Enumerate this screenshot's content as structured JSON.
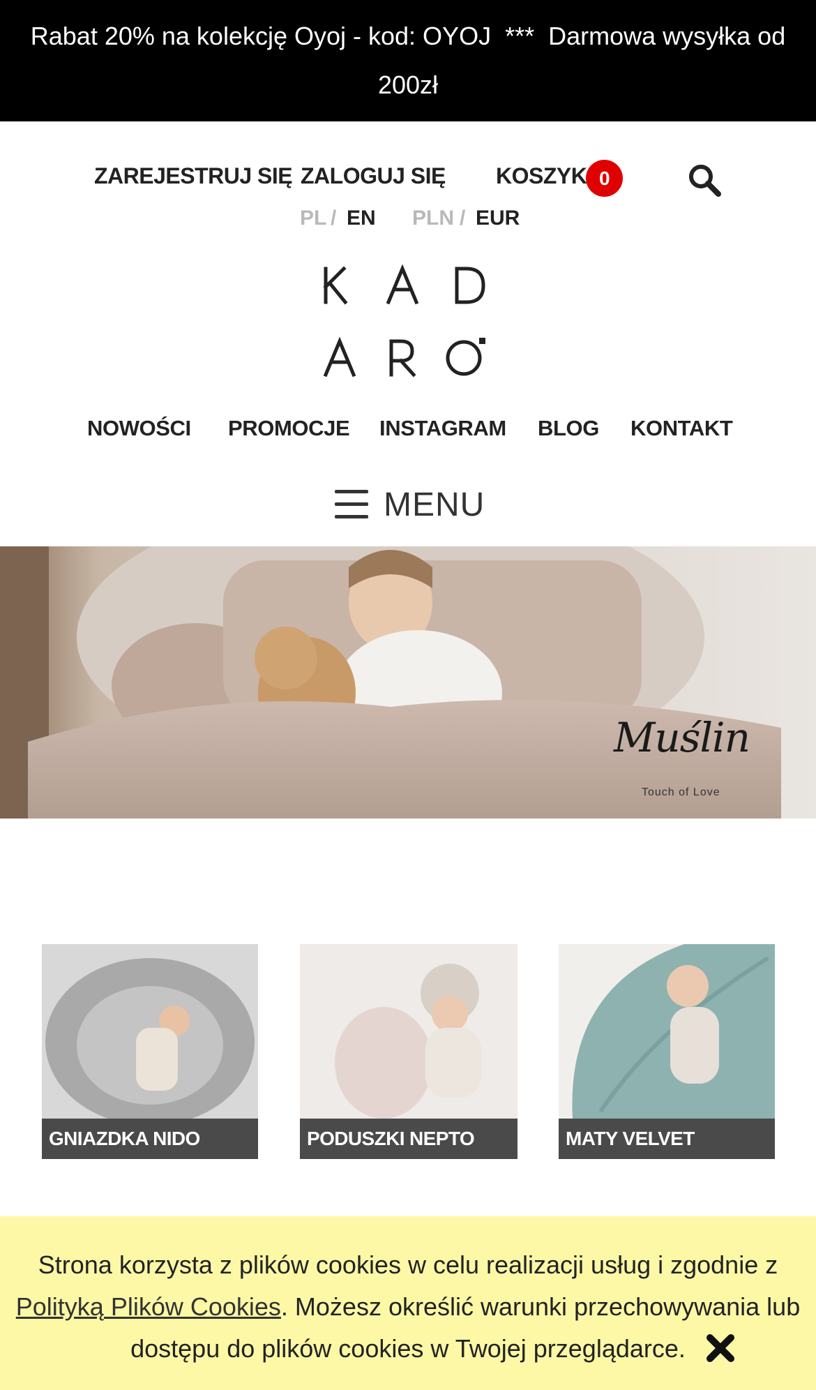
{
  "promo": {
    "line1": "Rabat 20% na kolekcję Oyoj - kod: OYOJ  ***  Darmowa wysyłka od",
    "line2": "200zł"
  },
  "user_nav": {
    "register": "ZAREJESTRUJ SIĘ",
    "login": "ZALOGUJ SIĘ",
    "cart": "KOSZYK",
    "cart_count": "0",
    "search_icon": "search-icon"
  },
  "languages": {
    "pl": "PL",
    "separator": "/",
    "en": "EN"
  },
  "currencies": {
    "pln": "PLN",
    "separator": "/",
    "eur": "EUR"
  },
  "logo": {
    "line1": "K A D",
    "line2": "A R O"
  },
  "main_nav": [
    "NOWOŚCI",
    "PROMOCJE",
    "INSTAGRAM",
    "BLOG",
    "KONTAKT"
  ],
  "menu": {
    "label": "MENU",
    "icon": "hamburger-icon"
  },
  "hero": {
    "script_title": "Muślin",
    "tagline": "Touch of Love"
  },
  "categories": [
    {
      "label": "GNIAZDKA NIDO"
    },
    {
      "label": "PODUSZKI NEPTO"
    },
    {
      "label": "MATY VELVET"
    }
  ],
  "cookie": {
    "text_before": "Strona korzysta z plików cookies w celu realizacji usług i zgodnie z ",
    "link": "Polityką Plików Cookies",
    "text_after": ". Możesz określić warunki przechowywania lub dostępu do plików cookies w Twojej przeglądarce.",
    "close_icon": "close-icon"
  },
  "colors": {
    "promo_bg": "#000000",
    "badge": "#e00000",
    "caption_bg": "#4a4a4a",
    "cookie_bg": "#fcf8a6",
    "muted": "#b9b9b9"
  }
}
